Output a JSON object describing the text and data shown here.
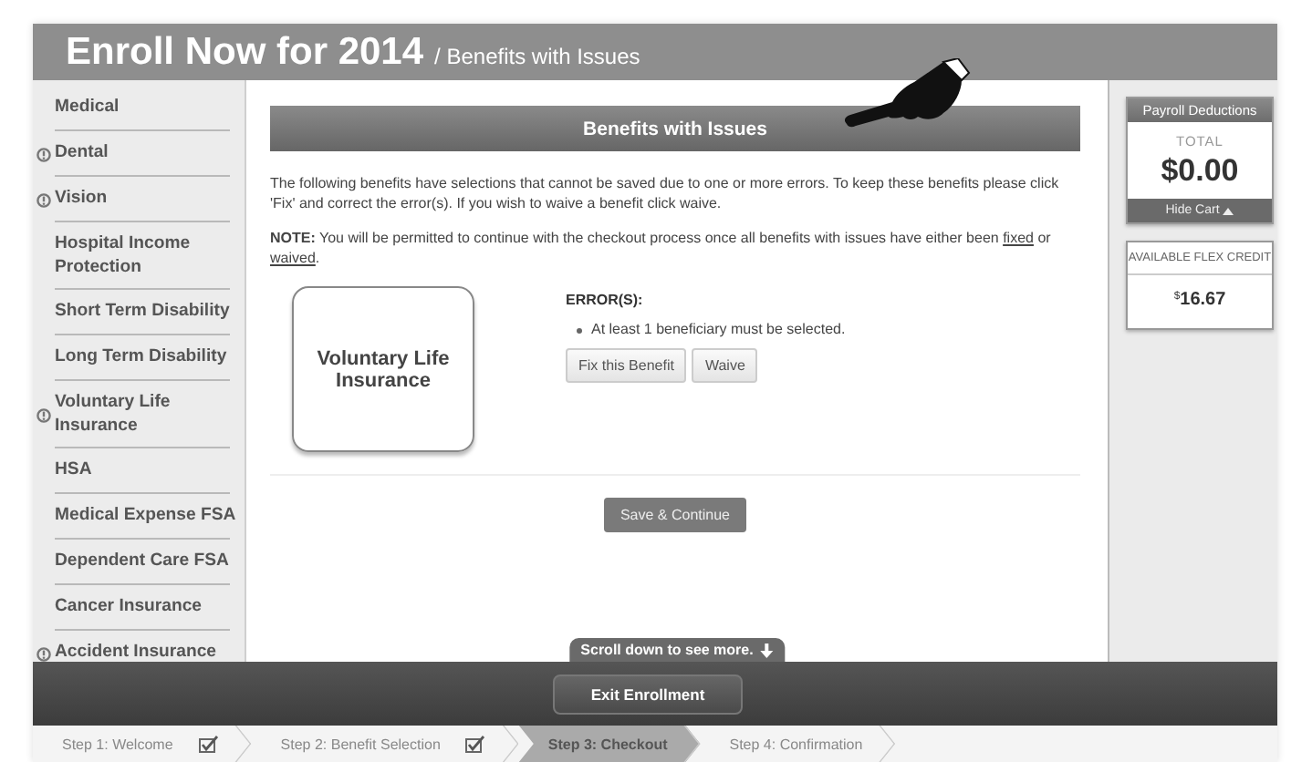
{
  "header": {
    "title": "Enroll Now for 2014",
    "subtitle": "/ Benefits with Issues"
  },
  "sidebar": {
    "items": [
      {
        "label": "Medical",
        "has_issue": false
      },
      {
        "label": "Dental",
        "has_issue": true
      },
      {
        "label": "Vision",
        "has_issue": true
      },
      {
        "label": "Hospital Income Protection",
        "has_issue": false
      },
      {
        "label": "Short Term Disability",
        "has_issue": false
      },
      {
        "label": "Long Term Disability",
        "has_issue": false
      },
      {
        "label": "Voluntary Life Insurance",
        "has_issue": true
      },
      {
        "label": "HSA",
        "has_issue": false
      },
      {
        "label": "Medical Expense FSA",
        "has_issue": false
      },
      {
        "label": "Dependent Care FSA",
        "has_issue": false
      },
      {
        "label": "Cancer Insurance",
        "has_issue": false
      },
      {
        "label": "Accident Insurance",
        "has_issue": true
      }
    ]
  },
  "main": {
    "banner": "Benefits with Issues",
    "intro": "The following benefits have selections that cannot be saved due to one or more errors. To keep these benefits please click 'Fix' and correct the error(s). If you wish to waive a benefit click waive.",
    "note": {
      "label": "NOTE:",
      "text": "You will be permitted to continue with the checkout process once all benefits with issues have either been",
      "link_1": "fixed",
      "joiner": "or",
      "link_2": "waived",
      "end": "."
    },
    "issues": [
      {
        "benefit": "Voluntary Life Insurance",
        "errors_heading": "ERROR(S):",
        "errors": [
          "At least 1 beneficiary must be selected."
        ],
        "buttons": [
          "Fix this Benefit",
          "Waive"
        ]
      }
    ],
    "save_button": "Save & Continue",
    "scroll_hint": "Scroll down to see more."
  },
  "cart": {
    "title": "Payroll Deductions",
    "total_label": "TOTAL",
    "total": "$0.00",
    "toggle": "Hide Cart",
    "expanded": true
  },
  "flex_credit": {
    "label": "AVAILABLE FLEX CREDIT",
    "currency": "$",
    "amount": "16.67"
  },
  "exit_button": "Exit Enrollment",
  "steps": [
    {
      "label": "Step 1: Welcome",
      "completed": true,
      "selected": false
    },
    {
      "label": "Step 2: Benefit Selection",
      "completed": true,
      "selected": false
    },
    {
      "label": "Step 3: Checkout",
      "completed": false,
      "selected": true
    },
    {
      "label": "Step 4: Confirmation",
      "completed": false,
      "selected": false
    }
  ]
}
